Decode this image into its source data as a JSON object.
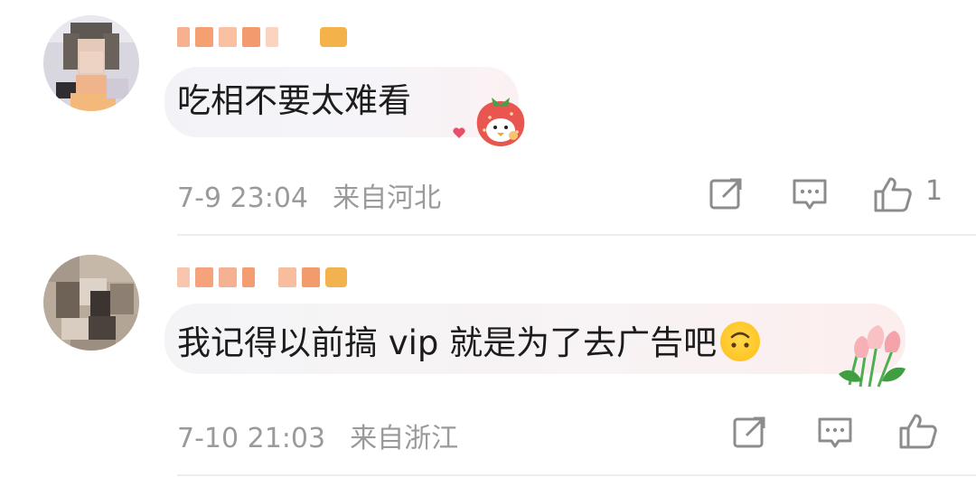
{
  "comments": [
    {
      "text": "吃相不要太难看",
      "time": "7-9 23:04",
      "location": "来自河北",
      "like_count": "1",
      "sticker_icon": "strawberry-bird-sticker-icon",
      "badge_icon": "fan-badge-icon"
    },
    {
      "text": "我记得以前搞 vip 就是为了去广告吧",
      "time": "7-10 21:03",
      "location": "来自浙江",
      "like_count": "",
      "inline_emoji": "upside-down-face-icon",
      "sticker_icon": "tulip-bouquet-sticker-icon",
      "badge_icon": "fan-badge-icon"
    }
  ],
  "colors": {
    "meta_text": "#9a9a9a",
    "divider": "#ededed",
    "icon_stroke": "#8c8c8c"
  }
}
